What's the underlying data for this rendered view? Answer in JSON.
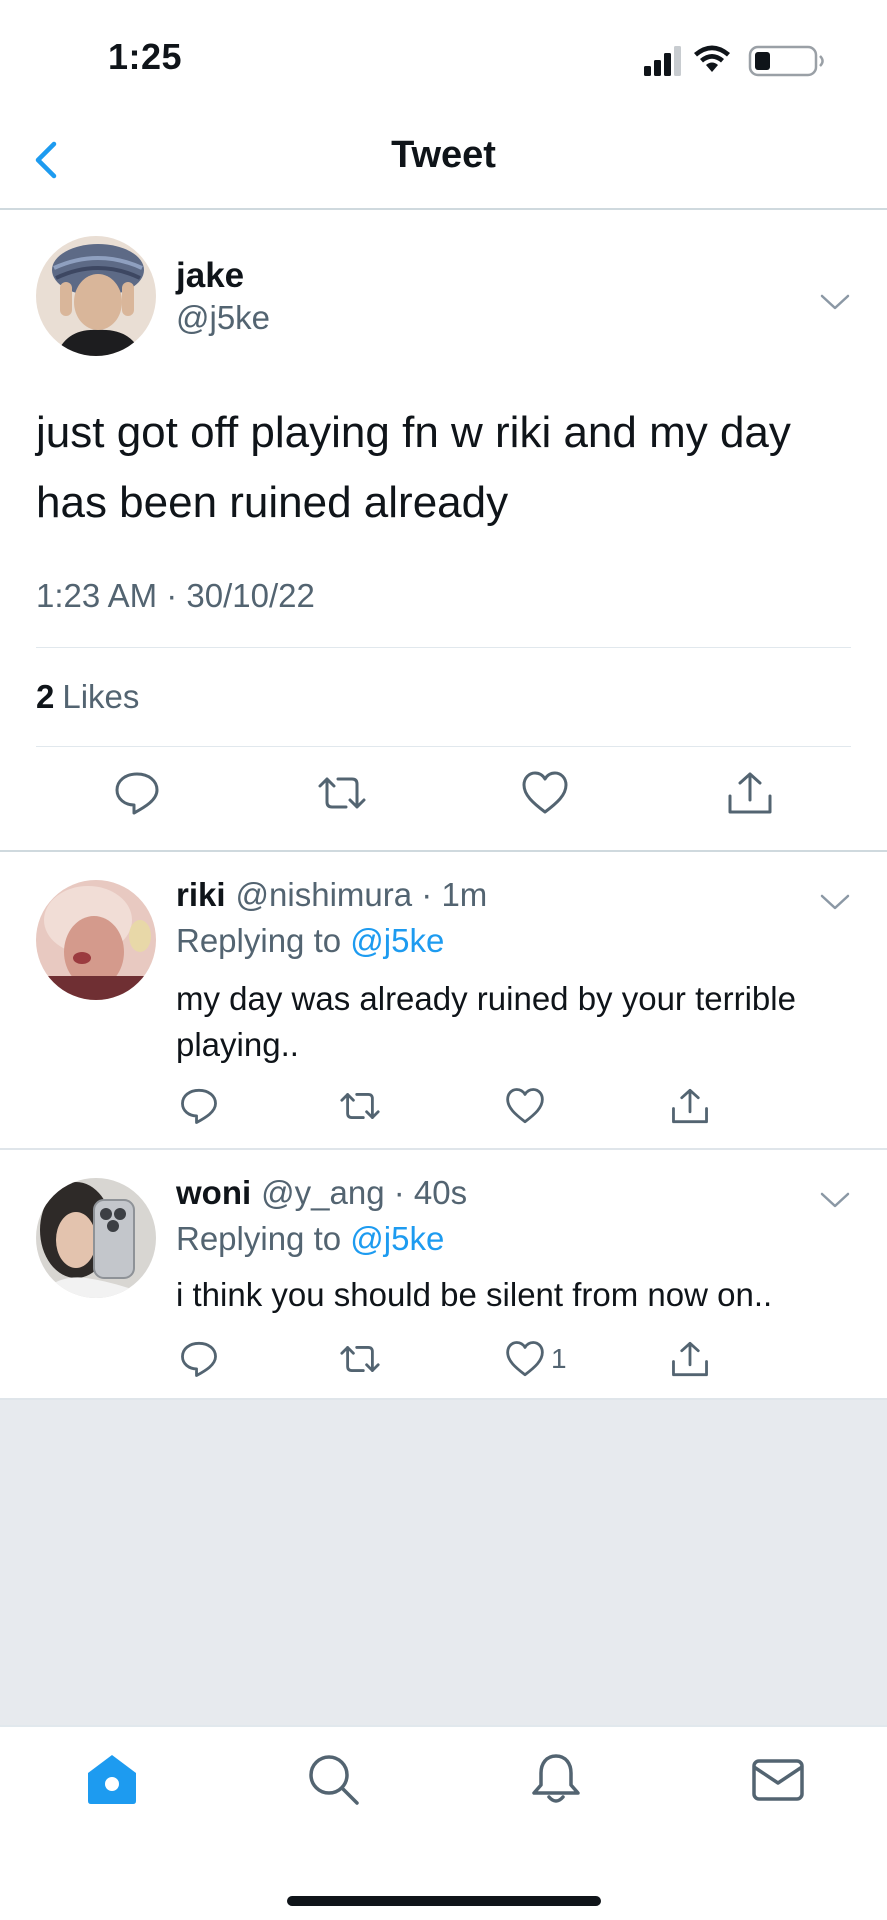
{
  "status_bar": {
    "time": "1:25"
  },
  "nav": {
    "title": "Tweet"
  },
  "main_tweet": {
    "name": "jake",
    "handle": "@j5ke",
    "text": "just got off playing fn w riki and my day has been ruined already",
    "timestamp": "1:23 AM · 30/10/22",
    "likes_count": "2",
    "likes_label": "Likes"
  },
  "replies": [
    {
      "name": "riki",
      "handle": "@nishimura",
      "separator": " · ",
      "time": "1m",
      "replying_prefix": "Replying to ",
      "replying_to": "@j5ke",
      "text": "my day was already ruined by your terrible playing..",
      "like_count": ""
    },
    {
      "name": "woni",
      "handle": "@y_ang",
      "separator": " · ",
      "time": "40s",
      "replying_prefix": "Replying to ",
      "replying_to": "@j5ke",
      "text": "i think you should be silent from now on..",
      "like_count": "1"
    }
  ],
  "colors": {
    "accent": "#1d9bf0",
    "text_primary": "#0f1419",
    "text_secondary": "#536471",
    "divider": "#cfd9de",
    "empty_background": "#e7eaee"
  },
  "icons": {
    "back": "chevron-left-icon",
    "reply": "speech-bubble-icon",
    "retweet": "retweet-icon",
    "like": "heart-icon",
    "share": "share-upload-icon",
    "tabs": [
      "home-icon",
      "search-icon",
      "bell-icon",
      "mail-icon"
    ]
  }
}
